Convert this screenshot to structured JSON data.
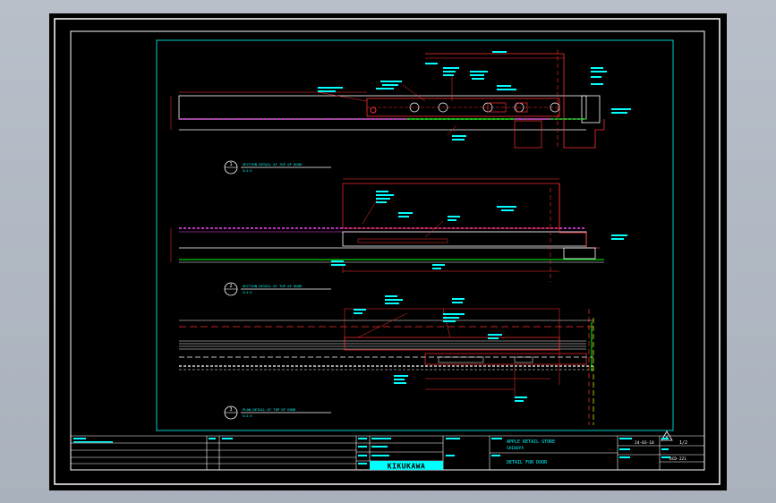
{
  "drawing": {
    "views": [
      {
        "number": "1",
        "title": "SECTION DETAIL AT TOP OF DOOR",
        "scale": "S=1:5"
      },
      {
        "number": "2",
        "title": "SECTION DETAIL AT TOP OF DOOR",
        "scale": "S=1:5"
      },
      {
        "number": "3",
        "title": "PLAN DETAIL AT TOP OF DOOR",
        "scale": "S=1:5"
      }
    ]
  },
  "title_block": {
    "company_logo": "KIKUKAWA",
    "project_name": "APPLE RETAIL STORE",
    "project_sub": "SHIBUYA",
    "drawing_title": "DETAIL FOR DOOR",
    "date": "24-03-18",
    "sheet": "1/2",
    "drawing_no": "DCD-221",
    "revision_symbol": "A"
  }
}
